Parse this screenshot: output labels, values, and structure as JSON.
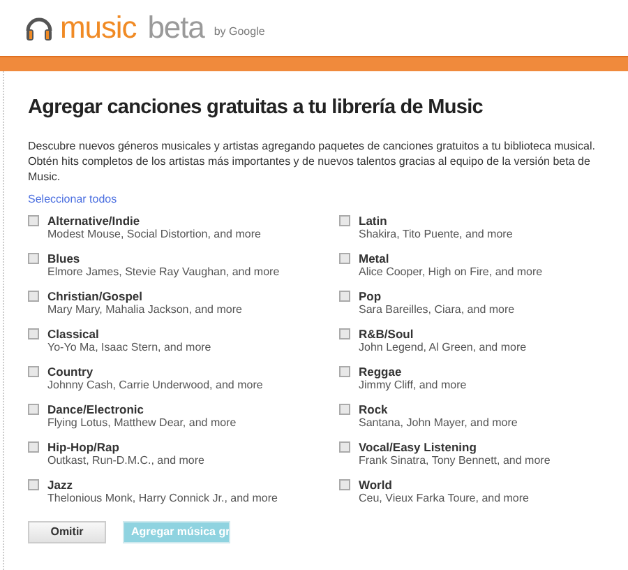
{
  "logo": {
    "product": "music",
    "tag": "beta",
    "by": "by Google"
  },
  "title": "Agregar canciones gratuitas a tu librería de Music",
  "description": "Descubre nuevos géneros musicales y artistas agregando paquetes de canciones gratuitos a tu biblioteca musical. Obtén hits completos de los artistas más importantes y de nuevos talentos gracias al equipo de la versión beta de Music.",
  "select_all": "Seleccionar todos",
  "columns": [
    {
      "genres": [
        {
          "name": "Alternative/Indie",
          "artists": "Modest Mouse, Social Distortion, and more",
          "checked": false
        },
        {
          "name": "Blues",
          "artists": "Elmore James, Stevie Ray Vaughan, and more",
          "checked": false
        },
        {
          "name": "Christian/Gospel",
          "artists": "Mary Mary, Mahalia Jackson, and more",
          "checked": false
        },
        {
          "name": "Classical",
          "artists": "Yo-Yo Ma, Isaac Stern, and more",
          "checked": false
        },
        {
          "name": "Country",
          "artists": "Johnny Cash, Carrie Underwood, and more",
          "checked": false
        },
        {
          "name": "Dance/Electronic",
          "artists": "Flying Lotus, Matthew Dear, and more",
          "checked": false
        },
        {
          "name": "Hip-Hop/Rap",
          "artists": "Outkast, Run-D.M.C., and more",
          "checked": false
        },
        {
          "name": "Jazz",
          "artists": "Thelonious Monk, Harry Connick Jr., and more",
          "checked": false
        }
      ]
    },
    {
      "genres": [
        {
          "name": "Latin",
          "artists": "Shakira, Tito Puente, and more",
          "checked": false
        },
        {
          "name": "Metal",
          "artists": "Alice Cooper, High on Fire, and more",
          "checked": false
        },
        {
          "name": "Pop",
          "artists": "Sara Bareilles, Ciara, and more",
          "checked": false
        },
        {
          "name": "R&B/Soul",
          "artists": "John Legend, Al Green, and more",
          "checked": false
        },
        {
          "name": "Reggae",
          "artists": "Jimmy Cliff, and more",
          "checked": false
        },
        {
          "name": "Rock",
          "artists": "Santana, John Mayer, and more",
          "checked": false
        },
        {
          "name": "Vocal/Easy Listening",
          "artists": "Frank Sinatra, Tony Bennett, and more",
          "checked": false
        },
        {
          "name": "World",
          "artists": "Ceu, Vieux Farka Toure, and more",
          "checked": false
        }
      ]
    }
  ],
  "buttons": [
    {
      "label": "Omitir",
      "kind": "secondary"
    },
    {
      "label": "Agregar música gr",
      "kind": "primary"
    }
  ]
}
